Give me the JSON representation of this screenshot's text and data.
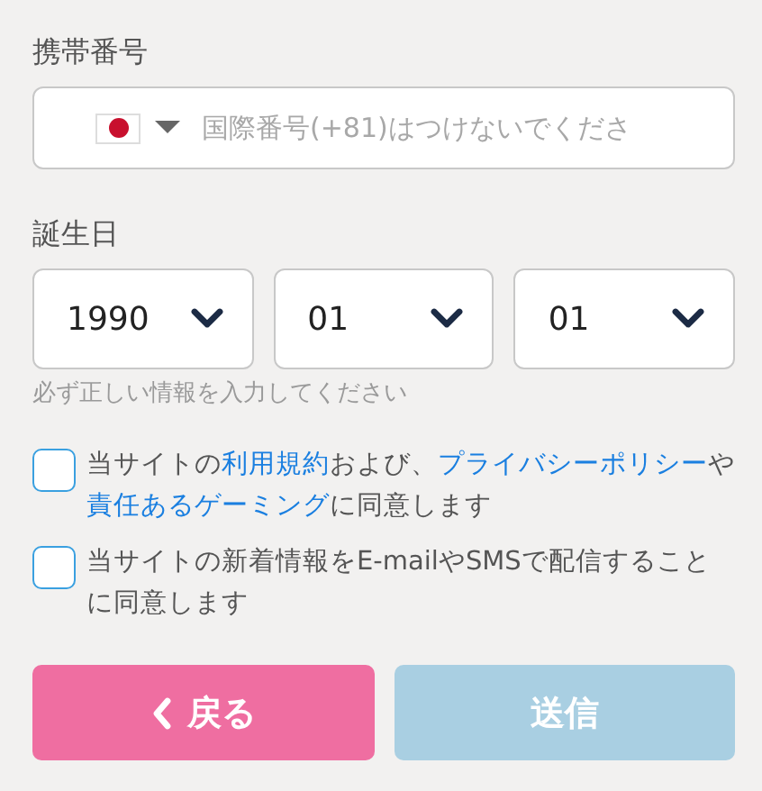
{
  "phone": {
    "label": "携帯番号",
    "placeholder": "国際番号(+81)はつけないでくださ"
  },
  "birthday": {
    "label": "誕生日",
    "selects": [
      {
        "value": "1990"
      },
      {
        "value": "01"
      },
      {
        "value": "01"
      }
    ],
    "hint": "必ず正しい情報を入力してください"
  },
  "agreements": [
    {
      "checked": false,
      "segments": [
        {
          "kind": "text",
          "text": "当サイトの"
        },
        {
          "kind": "link",
          "text": "利用規約"
        },
        {
          "kind": "text",
          "text": "および、"
        },
        {
          "kind": "link",
          "text": "プライバシーポリシー"
        },
        {
          "kind": "text",
          "text": "や"
        },
        {
          "kind": "link",
          "text": "責任あるゲーミング"
        },
        {
          "kind": "text",
          "text": "に同意します"
        }
      ]
    },
    {
      "checked": false,
      "segments": [
        {
          "kind": "text",
          "text": "当サイトの新着情報をE-mailやSMSで配信することに同意します"
        }
      ]
    }
  ],
  "buttons": [
    {
      "kind": "back",
      "label": "戻る",
      "disabled": false
    },
    {
      "kind": "submit",
      "label": "送信",
      "disabled": true
    }
  ]
}
